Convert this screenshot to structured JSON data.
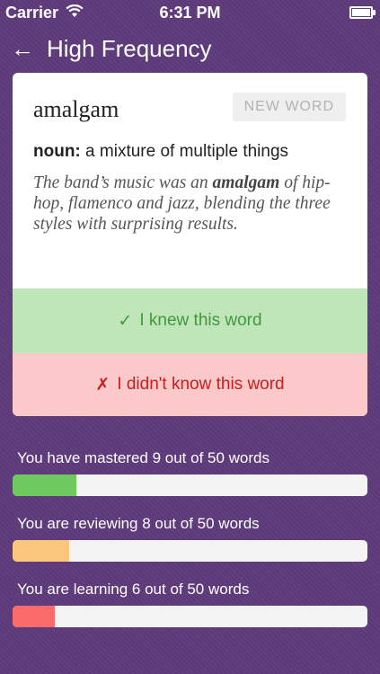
{
  "status_bar": {
    "carrier": "Carrier",
    "time": "6:31 PM",
    "wifi_icon": "wifi-icon",
    "battery_icon": "battery-icon"
  },
  "nav": {
    "back_icon": "back-arrow-icon",
    "back_glyph": "←",
    "title": "High Frequency"
  },
  "card": {
    "word": "amalgam",
    "badge": "NEW WORD",
    "part_of_speech": "noun:",
    "definition": "a mixture of multiple things",
    "example_before": "The band’s music was an ",
    "example_word": "amalgam",
    "example_after": " of hip-hop, flamenco and jazz, blending the three styles with surprising results.",
    "knew_mark": "✓",
    "knew_label": "I knew this word",
    "didnt_mark": "✗",
    "didnt_label": "I didn't know this word"
  },
  "progress": [
    {
      "label": "You have mastered 9 out of 50 words",
      "value": 9,
      "total": 50,
      "color": "#6ec95f"
    },
    {
      "label": "You are reviewing 8 out of 50 words",
      "value": 8,
      "total": 50,
      "color": "#fcc77c"
    },
    {
      "label": "You are learning 6 out of 50 words",
      "value": 6,
      "total": 50,
      "color": "#fb6b6b"
    }
  ],
  "colors": {
    "background": "#5e3a7a",
    "knew_bg": "#bfe6b8",
    "knew_text": "#3f9a3a",
    "didnt_bg": "#fbc9c9",
    "didnt_text": "#c81e1e"
  }
}
